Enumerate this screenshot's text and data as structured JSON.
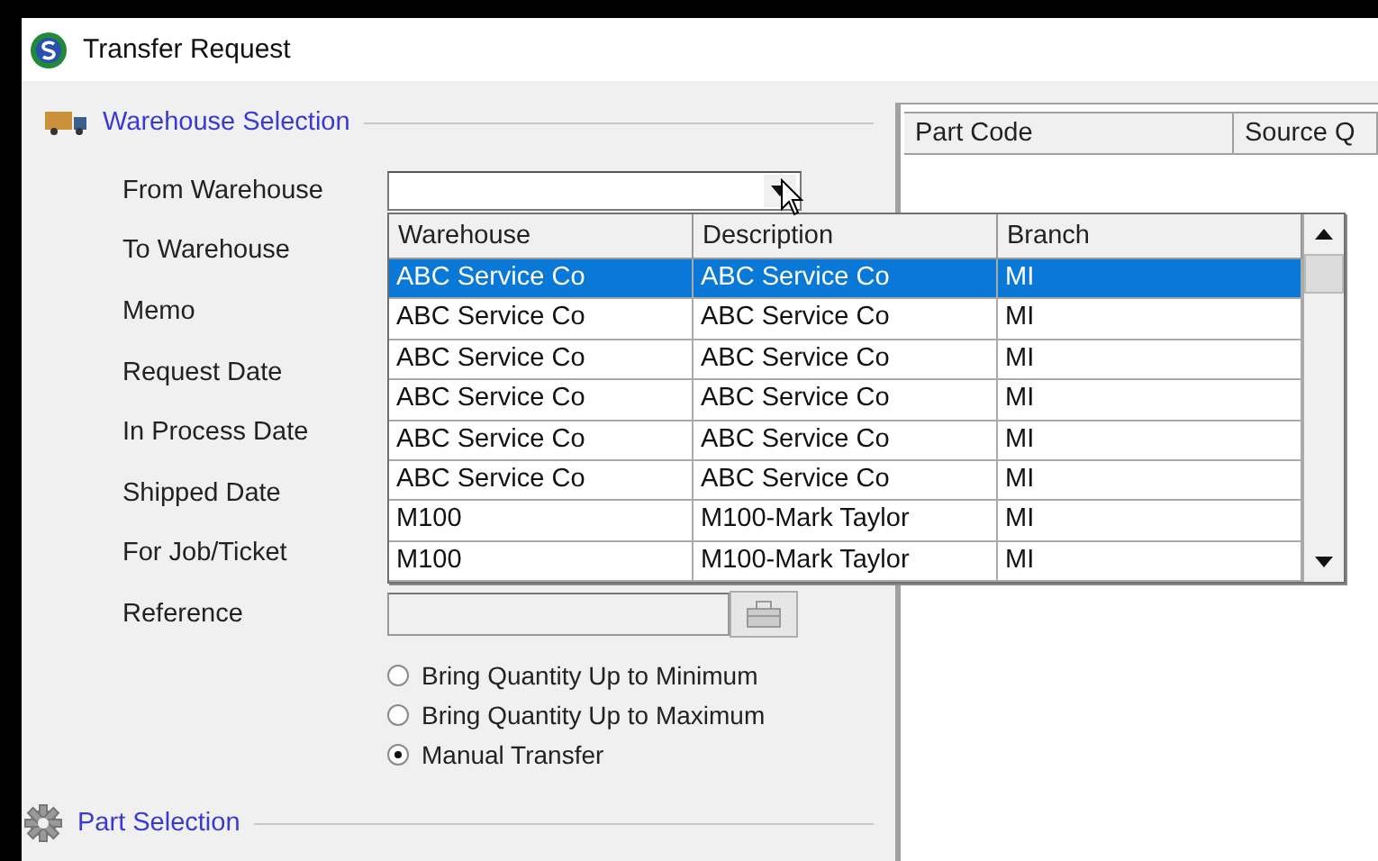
{
  "window": {
    "title": "Transfer Request"
  },
  "warehouse_section": {
    "title": "Warehouse Selection",
    "fields": [
      {
        "label": "From Warehouse",
        "kind": "combo"
      },
      {
        "label": "To Warehouse",
        "kind": "label"
      },
      {
        "label": "Memo",
        "kind": "label"
      },
      {
        "label": "Request Date",
        "kind": "label"
      },
      {
        "label": "In Process Date",
        "kind": "label"
      },
      {
        "label": "Shipped Date",
        "kind": "label"
      },
      {
        "label": "For Job/Ticket",
        "kind": "label"
      },
      {
        "label": "Reference",
        "kind": "lookup",
        "disabled": true
      }
    ],
    "transfer_modes": [
      {
        "label": "Bring Quantity Up to Minimum",
        "selected": false
      },
      {
        "label": "Bring Quantity Up to Maximum",
        "selected": false
      },
      {
        "label": "Manual Transfer",
        "selected": true
      }
    ]
  },
  "part_section": {
    "title": "Part Selection"
  },
  "parts_grid": {
    "columns": [
      "Part Code",
      "Source Q"
    ]
  },
  "warehouse_dropdown": {
    "columns": [
      "Warehouse",
      "Description",
      "Branch"
    ],
    "rows": [
      {
        "cells": [
          "ABC Service Co",
          "ABC Service Co",
          "MI"
        ],
        "selected": true
      },
      {
        "cells": [
          "ABC Service Co",
          "ABC Service Co",
          "MI"
        ],
        "selected": false
      },
      {
        "cells": [
          "ABC Service Co",
          "ABC Service Co",
          "MI"
        ],
        "selected": false
      },
      {
        "cells": [
          "ABC Service Co",
          "ABC Service Co",
          "MI"
        ],
        "selected": false
      },
      {
        "cells": [
          "ABC Service Co",
          "ABC Service Co",
          "MI"
        ],
        "selected": false
      },
      {
        "cells": [
          "ABC Service Co",
          "ABC Service Co",
          "MI"
        ],
        "selected": false
      },
      {
        "cells": [
          "M100",
          "M100-Mark Taylor",
          "MI"
        ],
        "selected": false
      },
      {
        "cells": [
          "M100",
          "M100-Mark Taylor",
          "MI"
        ],
        "selected": false
      }
    ]
  }
}
